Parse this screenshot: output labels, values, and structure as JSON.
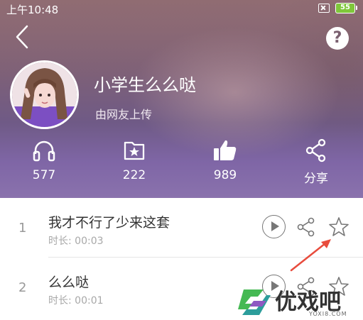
{
  "status_bar": {
    "time": "上午10:48",
    "battery": "55"
  },
  "profile": {
    "name": "小学生么么哒",
    "subtitle": "由网友上传"
  },
  "stats": [
    {
      "icon": "headphones-icon",
      "value": "577"
    },
    {
      "icon": "star-badge-icon",
      "value": "222"
    },
    {
      "icon": "thumbs-up-icon",
      "value": "989"
    },
    {
      "icon": "share-icon",
      "value": "分享"
    }
  ],
  "tracks": [
    {
      "index": "1",
      "title": "我才不行了少来这套",
      "duration": "时长: 00:03"
    },
    {
      "index": "2",
      "title": "么么哒",
      "duration": "时长: 00:01"
    }
  ],
  "watermark": {
    "text": "优戏吧",
    "url": "YOXI8.COM"
  },
  "colors": {
    "header_purple": "#7f66a6",
    "arrow_red": "#e84c3d",
    "watermark_green": "#3bb54a"
  }
}
